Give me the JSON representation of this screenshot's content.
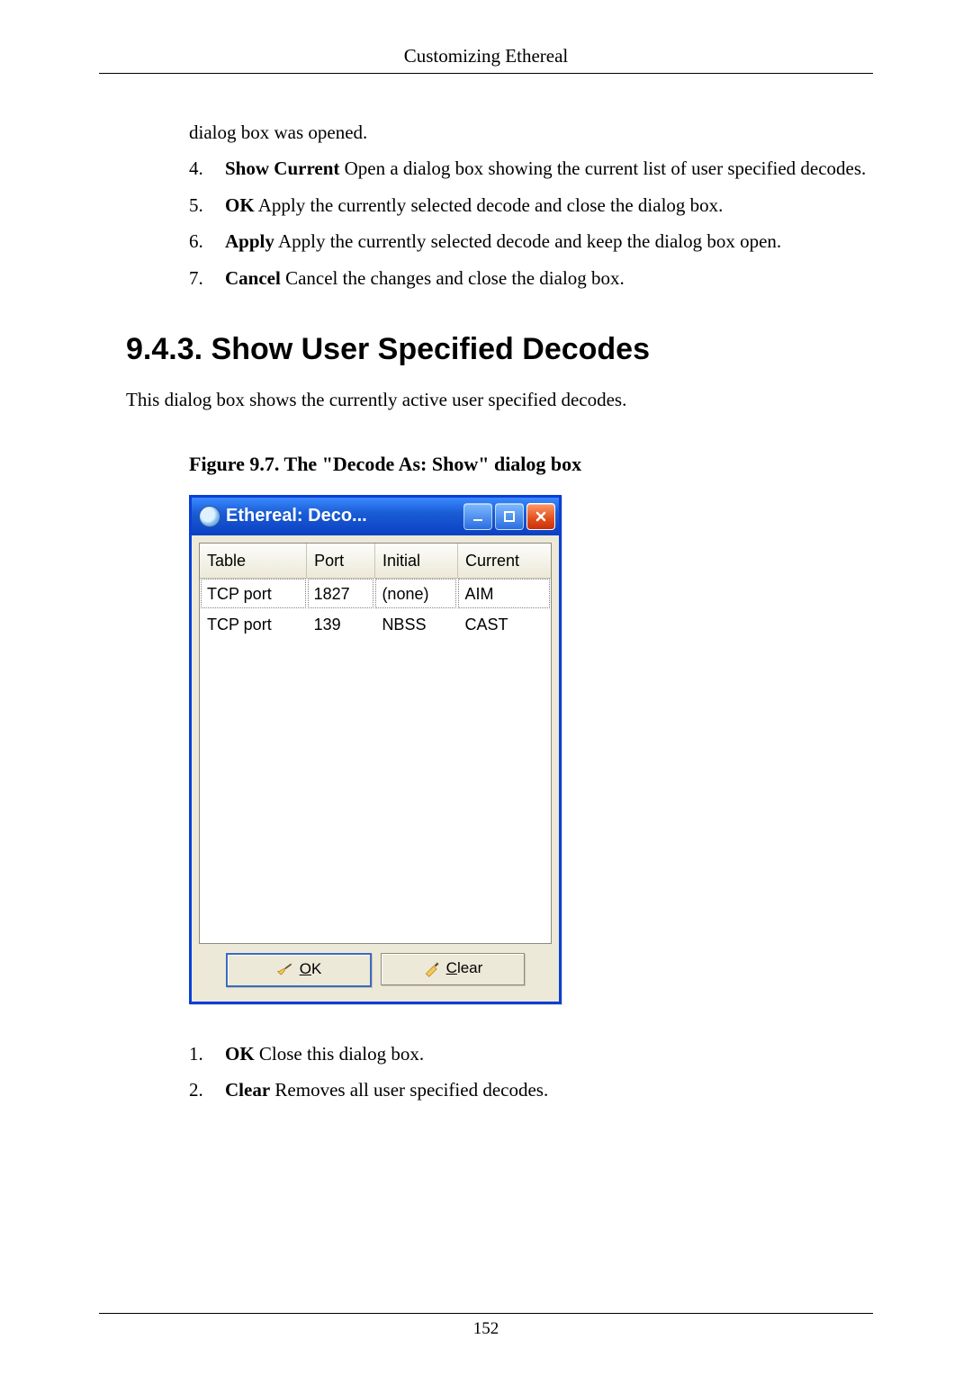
{
  "header": {
    "title": "Customizing Ethereal"
  },
  "intro_continuation": "dialog box was opened.",
  "list_top": [
    {
      "num": "4.",
      "bold": "Show Current",
      "text": " Open a dialog box showing the current list of user specified decodes."
    },
    {
      "num": "5.",
      "bold": "OK",
      "text": " Apply the currently selected decode and close the dialog box."
    },
    {
      "num": "6.",
      "bold": "Apply",
      "text": " Apply the currently selected decode and keep the dialog box open."
    },
    {
      "num": "7.",
      "bold": "Cancel",
      "text": " Cancel the changes and close the dialog box."
    }
  ],
  "section_heading": "9.4.3. Show User Specified Decodes",
  "section_para": "This dialog box shows the currently active user specified decodes.",
  "figure_caption": "Figure 9.7. The \"Decode As: Show\" dialog box",
  "dialog": {
    "title": "Ethereal: Deco...",
    "columns": [
      "Table",
      "Port",
      "Initial",
      "Current"
    ],
    "rows": [
      {
        "table": "TCP port",
        "port": "1827",
        "initial": "(none)",
        "current": "AIM"
      },
      {
        "table": "TCP port",
        "port": "139",
        "initial": "NBSS",
        "current": "CAST"
      }
    ],
    "buttons": {
      "ok_mnemonic": "O",
      "ok_rest": "K",
      "clear_mnemonic": "C",
      "clear_rest": "lear"
    }
  },
  "list_bottom": [
    {
      "num": "1.",
      "bold": "OK",
      "text": " Close this dialog box."
    },
    {
      "num": "2.",
      "bold": "Clear",
      "text": " Removes all user specified decodes."
    }
  ],
  "page_number": "152"
}
